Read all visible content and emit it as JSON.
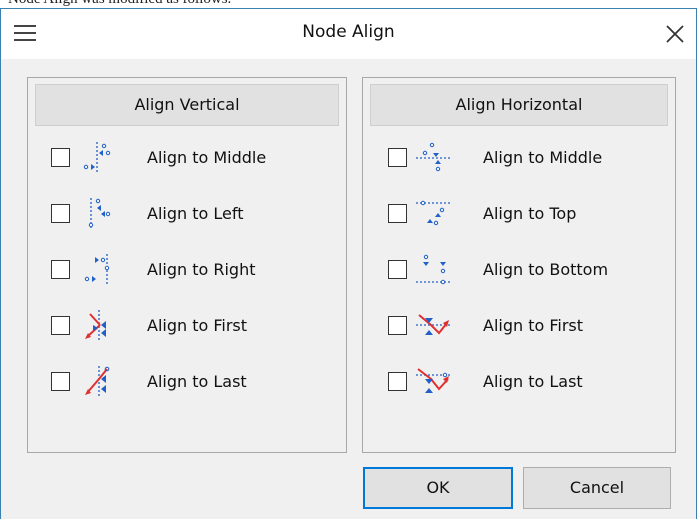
{
  "background_text": "Node Align was modified as follows.",
  "window": {
    "title": "Node Align",
    "menu_icon": "hamburger-menu-icon",
    "close_icon": "close-icon"
  },
  "vertical_group": {
    "title": "Align Vertical",
    "options": [
      {
        "label": "Align to Middle",
        "icon": "align-vertical-middle-icon",
        "checked": false
      },
      {
        "label": "Align to Left",
        "icon": "align-left-icon",
        "checked": false
      },
      {
        "label": "Align to Right",
        "icon": "align-right-icon",
        "checked": false
      },
      {
        "label": "Align to First",
        "icon": "align-vertical-first-icon",
        "checked": false
      },
      {
        "label": "Align to Last",
        "icon": "align-vertical-last-icon",
        "checked": false
      }
    ]
  },
  "horizontal_group": {
    "title": "Align Horizontal",
    "options": [
      {
        "label": "Align to Middle",
        "icon": "align-horizontal-middle-icon",
        "checked": false
      },
      {
        "label": "Align to Top",
        "icon": "align-top-icon",
        "checked": false
      },
      {
        "label": "Align to Bottom",
        "icon": "align-bottom-icon",
        "checked": false
      },
      {
        "label": "Align to First",
        "icon": "align-horizontal-first-icon",
        "checked": false
      },
      {
        "label": "Align to Last",
        "icon": "align-horizontal-last-icon",
        "checked": false
      }
    ]
  },
  "buttons": {
    "ok": "OK",
    "cancel": "Cancel"
  },
  "colors": {
    "icon_blue": "#2060c8",
    "icon_red": "#e03030",
    "ok_border": "#0078d7",
    "window_border": "#3c7fb1"
  }
}
